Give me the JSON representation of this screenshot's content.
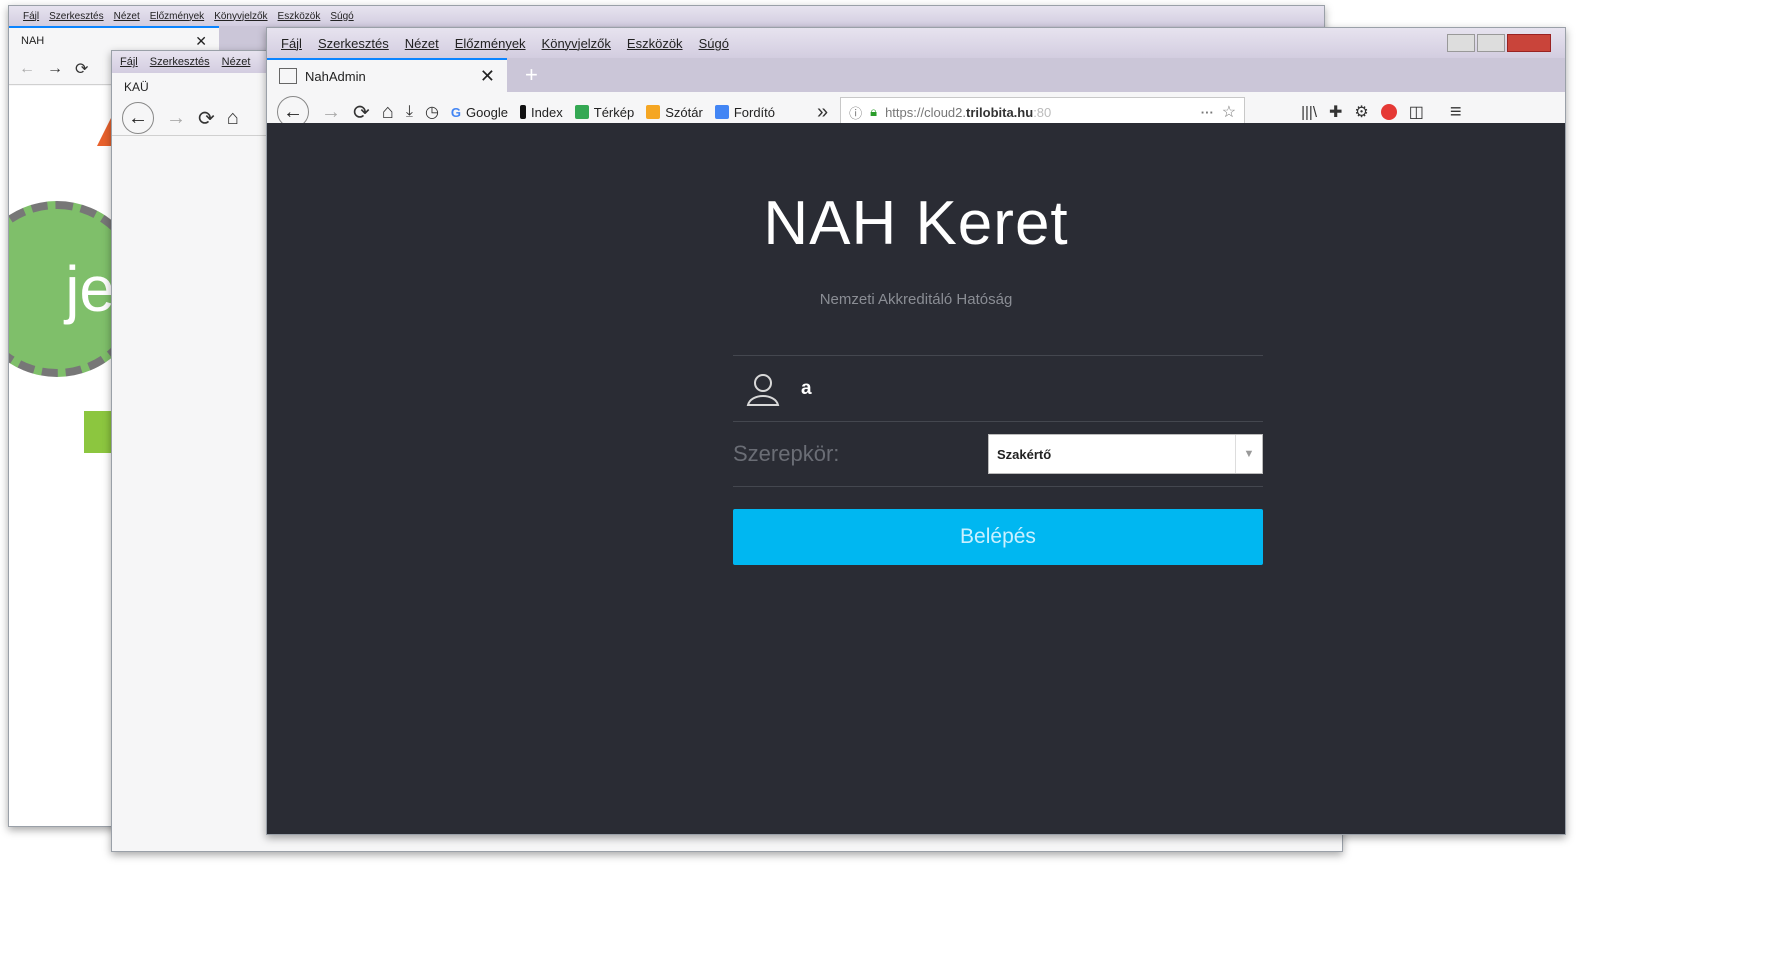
{
  "menu": {
    "file": "Fájl",
    "edit": "Szerkesztés",
    "view": "Nézet",
    "history": "Előzmények",
    "bookmarks": "Könyvjelzők",
    "tools": "Eszközök",
    "help": "Súgó"
  },
  "back_window1": {
    "tab_title": "NAH",
    "logo_text": "jek"
  },
  "back_window2": {
    "tab_title": "KAÜ"
  },
  "main_window": {
    "tab_title": "NahAdmin",
    "bookmarks": [
      "Google",
      "Index",
      "Térkép",
      "Szótár",
      "Fordító"
    ],
    "url_prefix": "https://cloud2.",
    "url_domain": "trilobita.hu",
    "url_suffix": ":80"
  },
  "login": {
    "title": "NAH Keret",
    "subtitle": "Nemzeti Akkreditáló Hatóság",
    "username_value": "a",
    "role_label": "Szerepkör:",
    "role_selected": "Szakértő",
    "submit_label": "Belépés"
  },
  "colors": {
    "page_bg": "#2a2c34",
    "button": "#00b7f1",
    "green_accent": "#8cc63f",
    "orange_logo": "#e8612c"
  }
}
